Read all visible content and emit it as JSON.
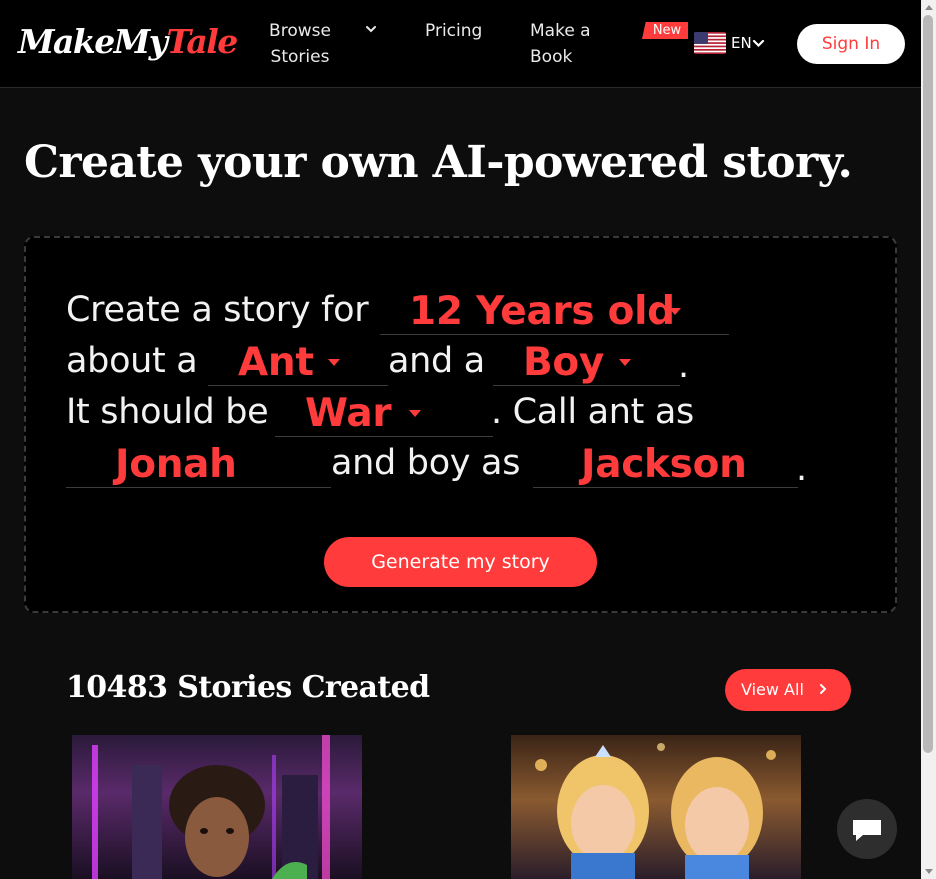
{
  "header": {
    "logo_part1": "MakeMy",
    "logo_part2": "Tale",
    "nav": {
      "browse_stories": "Browse Stories",
      "pricing": "Pricing",
      "make_a_book": "Make a Book"
    },
    "new_badge": "New",
    "language_flag": "us-flag-icon",
    "language": "EN",
    "sign_in": "Sign In"
  },
  "hero": {
    "title": "Create your own AI-powered story."
  },
  "story_form": {
    "line1_text": "Create a story for",
    "age": "12 Years old",
    "line2_text_a": "about a",
    "character1": "Ant",
    "line2_text_b": "and a",
    "character2": "Boy",
    "period": ".",
    "line3_text_a": "It should be",
    "theme": "War",
    "line3_text_b": ". Call ant as",
    "name1": "Jonah",
    "line4_text": "and boy as",
    "name2": "Jackson",
    "generate_button": "Generate my story"
  },
  "stories": {
    "heading": "10483 Stories Created",
    "view_all": "View All"
  },
  "colors": {
    "accent": "#ff3b3b",
    "background": "#0d0d0d",
    "header_bg": "#000000",
    "chat_button": "#2e2e2e"
  },
  "icons": {
    "browse_chevron": "chevron-down-icon",
    "language_chevron": "chevron-down-icon",
    "view_all_chevron": "chevron-right-icon",
    "chat": "chat-bubble-icon"
  }
}
